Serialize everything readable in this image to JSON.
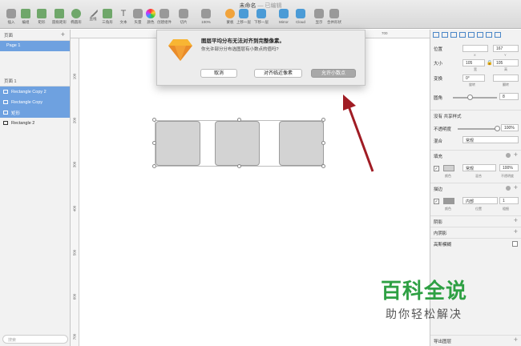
{
  "window": {
    "title": "未命名",
    "subtitle": "— 已编辑"
  },
  "toolbar": {
    "items": [
      {
        "label": "插入",
        "icon": "insert-icon"
      },
      {
        "label": "编组",
        "icon": "group-icon"
      },
      {
        "label": "矩形",
        "icon": "rectangle-icon"
      },
      {
        "label": "圆角矩形",
        "icon": "rounded-rectangle-icon"
      },
      {
        "label": "椭圆形",
        "icon": "oval-icon"
      },
      {
        "label": "直线",
        "icon": "line-icon"
      },
      {
        "label": "三角形",
        "icon": "triangle-icon"
      },
      {
        "label": "文本",
        "icon": "text-icon"
      },
      {
        "label": "矢量",
        "icon": "vector-icon"
      },
      {
        "label": "颜色",
        "icon": "color-icon"
      },
      {
        "label": "创建组件",
        "icon": "component-icon"
      },
      {
        "label": "切片",
        "icon": "slice-icon"
      },
      {
        "label": "100%",
        "icon": "zoom-icon"
      },
      {
        "label": "蒙板",
        "icon": "mask-icon"
      },
      {
        "label": "上移一层",
        "icon": "forward-icon"
      },
      {
        "label": "下移一层",
        "icon": "backward-icon"
      },
      {
        "label": "Mirror",
        "icon": "mirror-icon"
      },
      {
        "label": "Cloud",
        "icon": "cloud-icon"
      },
      {
        "label": "显示",
        "icon": "view-icon"
      },
      {
        "label": "合并形状",
        "icon": "union-icon"
      }
    ]
  },
  "sidebar": {
    "pages_header": "页面",
    "page": "Page 1",
    "layers_header": "页面 1",
    "layers": [
      {
        "name": "Rectangle Copy 2",
        "selected": true
      },
      {
        "name": "Rectangle Copy",
        "selected": true
      },
      {
        "name": "矩形",
        "selected": true
      },
      {
        "name": "Rectangle 2",
        "selected": false
      }
    ],
    "search_placeholder": "搜索"
  },
  "rulers": {
    "h": [
      "600",
      "700"
    ],
    "v": [
      "100",
      "200",
      "300",
      "400",
      "500",
      "600",
      "700"
    ]
  },
  "dialog": {
    "title": "图层平均分布无法对齐到完整像素。",
    "message": "你允许部分分布选图层有小数点的值吗?",
    "buttons": [
      "取消",
      "对齐临近像素",
      "允许小数点"
    ]
  },
  "inspector": {
    "position_label": "位置",
    "x": "",
    "y": "167",
    "x_cap": "X",
    "y_cap": "Y",
    "size_label": "大小",
    "w": "105",
    "h": "105",
    "w_cap": "宽",
    "h_cap": "高",
    "transform_label": "变换",
    "rotate": "0°",
    "rotate_cap": "旋转",
    "flip_cap": "翻转",
    "radius_label": "圆角",
    "radius": "8",
    "style_label": "没有 共享样式",
    "opacity_label": "不透明度",
    "opacity": "100%",
    "blend_label": "混合",
    "blend": "常规",
    "fill_label": "填充",
    "fill_blend": "常规",
    "fill_opacity": "100%",
    "fill_caps": [
      "颜色",
      "混合",
      "不透明度"
    ],
    "border_label": "描边",
    "border_pos": "内部",
    "border_width": "1",
    "border_caps": [
      "颜色",
      "位置",
      "粗细"
    ],
    "shadow_label": "阴影",
    "inner_shadow_label": "内阴影",
    "blur_label": "高斯模糊",
    "export_label": "导出图层"
  },
  "watermark": {
    "line1": "百科全说",
    "line2": "助你轻松解决"
  },
  "colors": {
    "selection": "#6ea1e0",
    "arrow": "#a01c24",
    "watermark": "#2ea043"
  }
}
